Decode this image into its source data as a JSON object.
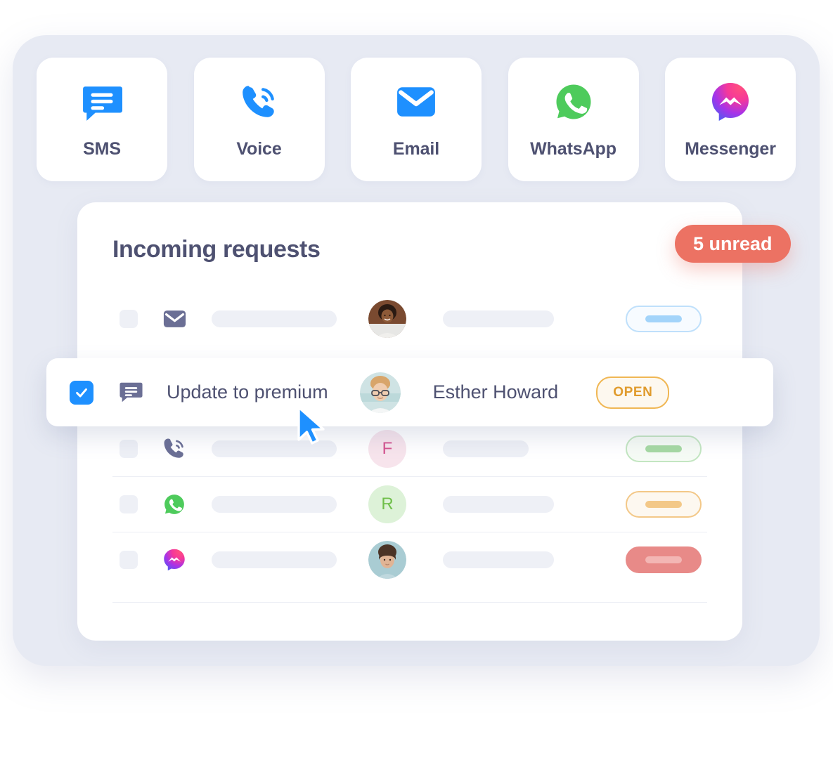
{
  "channels": [
    {
      "label": "SMS",
      "icon": "sms-chat-bubble-icon",
      "color": "#1e90ff"
    },
    {
      "label": "Voice",
      "icon": "phone-call-icon",
      "color": "#1e90ff"
    },
    {
      "label": "Email",
      "icon": "envelope-icon",
      "color": "#1e90ff"
    },
    {
      "label": "WhatsApp",
      "icon": "whatsapp-icon",
      "color": "#4ecb5c"
    },
    {
      "label": "Messenger",
      "icon": "messenger-icon",
      "color": "#9b30e0"
    }
  ],
  "header": {
    "title": "Incoming requests",
    "unread_badge": "5 unread",
    "unread_count": 5,
    "badge_color": "#ec7263"
  },
  "rows": [
    {
      "channel_icon": "envelope-icon",
      "icon_color": "#6b6f95",
      "subject_placeholder": true,
      "avatar_kind": "photo",
      "avatar_name": "avatar-photo-woman-smiling",
      "name_bar_width": 158,
      "status_style": "outline-blue",
      "status_border": "#bfe0fb",
      "status_fill": "#f7fbff",
      "status_inner": "#a3d4fa"
    },
    {
      "channel_icon": "phone-call-icon",
      "icon_color": "#6b6f95",
      "subject_placeholder": true,
      "avatar_kind": "letter",
      "avatar_letter": "F",
      "avatar_bg": "#f7e4ec",
      "avatar_fg": "#d4538f",
      "name_bar_width": 122,
      "status_style": "outline-green",
      "status_border": "#c3e6c1",
      "status_fill": "#f6fbf5",
      "status_inner": "#a6d9a3"
    },
    {
      "channel_icon": "whatsapp-icon",
      "icon_color": "#4ecb5c",
      "subject_placeholder": true,
      "avatar_kind": "letter",
      "avatar_letter": "R",
      "avatar_bg": "#ddf2d8",
      "avatar_fg": "#6fbf4a",
      "name_bar_width": 158,
      "status_style": "outline-orange",
      "status_border": "#f3c888",
      "status_fill": "#fdf8f0",
      "status_inner": "#f3c888"
    },
    {
      "channel_icon": "messenger-icon",
      "icon_color": "#9b30e0",
      "subject_placeholder": true,
      "avatar_kind": "photo",
      "avatar_name": "avatar-photo-woman-portrait",
      "name_bar_width": 158,
      "status_style": "solid-red",
      "status_border": "#e88a88",
      "status_fill": "#e88a88",
      "status_inner": "#f3b6b4"
    }
  ],
  "selected_row": {
    "checked": true,
    "checkbox_color": "#1e90ff",
    "channel_icon": "sms-chat-bubble-icon",
    "icon_color": "#6b6f95",
    "subject": "Update to premium",
    "contact_name": "Esther Howard",
    "avatar_name": "avatar-photo-young-man",
    "status_label": "OPEN",
    "status_color": "#e09b2d",
    "status_border_color": "#f0b754"
  },
  "cursor": {
    "name": "mouse-pointer",
    "color": "#1e90ff"
  },
  "theme": {
    "panel_bg": "#e7eaf3",
    "card_bg": "#ffffff",
    "text": "#4e5171",
    "placeholder": "#eef0f6",
    "divider": "#eceef5"
  }
}
